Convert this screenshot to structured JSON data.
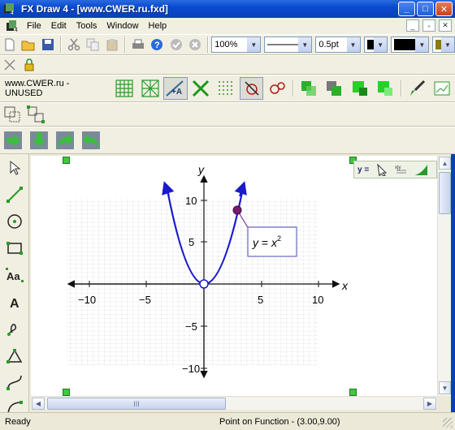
{
  "window": {
    "title": "FX Draw 4 - [www.CWER.ru.fxd]",
    "minimize": "_",
    "maximize": "□",
    "close": "✕"
  },
  "menu": {
    "items": [
      "File",
      "Edit",
      "Tools",
      "Window",
      "Help"
    ],
    "mdi": [
      "_",
      "▫",
      "✕"
    ]
  },
  "toolbar1": {
    "zoom": "100%",
    "line_size": "0.5pt"
  },
  "toolbar3": {
    "unused_label": "www.CWER.ru - UNUSED"
  },
  "mini_toolbar": {
    "label": "y ="
  },
  "graph": {
    "x_axis_label": "x",
    "y_axis_label": "y",
    "x_ticks": [
      "−10",
      "−5",
      "5",
      "10"
    ],
    "y_ticks": [
      "10",
      "5",
      "−5",
      "−10"
    ],
    "equation_lhs": "y",
    "equation_eq": "=",
    "equation_base": "x",
    "equation_exp": "2",
    "point": {
      "x": 3,
      "y": 9
    },
    "curve_color": "#1a1acc",
    "point_color": "#7a1a6e"
  },
  "hscroll": {
    "thumb_grip": "III"
  },
  "status": {
    "left": "Ready",
    "center": "Point on Function - (3.00,9.00)"
  }
}
